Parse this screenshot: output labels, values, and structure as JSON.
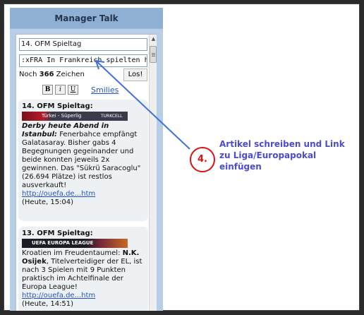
{
  "panel": {
    "title": "Manager Talk"
  },
  "compose": {
    "title_value": "14. OFM Spieltag",
    "body_value": ":xFRA In Frankreich spielten he",
    "counter_prefix": "Noch ",
    "counter_number": "366",
    "counter_suffix": " Zeichen",
    "submit_label": "Los!",
    "bold_label": "B",
    "italic_label": "i",
    "underline_label": "U",
    "smilies_label": "Smilies"
  },
  "posts": [
    {
      "heading": "14. OFM Spieltag:",
      "banner_left": "Türkei - Süperlig",
      "banner_right": "TURKCELL Süper Lig",
      "lead": "Derby heute Abend in Istanbul:",
      "text": " Fenerbahce empfängt Galatasaray. Bisher gabs 4 Begegnungen gegeinander und beide konnten jeweils 2x gewinnen. Das \"Sükrü Saracoglu\" (26.694 Plätze) ist restlos ausverkauft!",
      "link": "http://ouefa.de...htm",
      "time": "(Heute, 15:04)"
    },
    {
      "heading": "13. OFM Spieltag:",
      "banner_left": "UEFA EUROPA LEAGUE",
      "banner_right": "",
      "lead": "",
      "text_pre": "Kroatien im Freudentaumel: ",
      "text_bold": "N.K. Osijek",
      "text_post": ", Titelverteidiger der EL, ist nach 3 Spielen mit 9 Punkten praktisch im Achtelfinale der Europa League!",
      "link": "http://ouefa.de...htm",
      "time": "(Heute, 14:51)"
    }
  ],
  "annotation": {
    "step": "4.",
    "text": "Artikel schreiben und Link zu Liga/Europapokal einfügen",
    "circle_color": "#dd1111",
    "text_color": "#4b4bd6",
    "arrow_color": "#3f6fe0"
  }
}
